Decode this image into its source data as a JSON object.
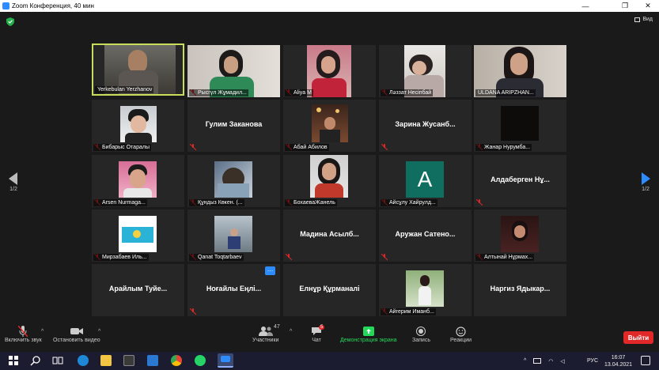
{
  "window": {
    "title": "Zoom Конференция, 40 мин"
  },
  "view": {
    "label": "Вид"
  },
  "pager": {
    "left": "1/2",
    "right": "1/2"
  },
  "tiles": [
    {
      "name": "Yerkebulan Yerzhanov",
      "video": true,
      "active": true,
      "muted": false
    },
    {
      "name": "Рысгүл Жұмадил...",
      "video": true,
      "muted": true
    },
    {
      "name": "Aliya M",
      "video": true,
      "muted": true
    },
    {
      "name": "Ләззат Несіпбай",
      "video": true,
      "muted": true
    },
    {
      "name": "ULDANA ARIPZHAN...",
      "video": true,
      "muted": false
    },
    {
      "name": "Бибарыс Отаралы",
      "video": true,
      "muted": true
    },
    {
      "name": "Гулим Заканова",
      "video": false,
      "muted": true
    },
    {
      "name": "Абай Абилов",
      "video": true,
      "muted": true
    },
    {
      "name": "Зарина Жусанб...",
      "video": false,
      "muted": true
    },
    {
      "name": "Жанар Нурумба...",
      "video": true,
      "muted": true
    },
    {
      "name": "Arsen Nurmaga...",
      "video": true,
      "muted": true
    },
    {
      "name": "Құндыз Көкен. (...",
      "video": true,
      "muted": true
    },
    {
      "name": "БохаеваЖанель",
      "video": true,
      "muted": true
    },
    {
      "name": "Айсұлу Хайрулд...",
      "video": true,
      "avatar_letter": "A",
      "muted": true
    },
    {
      "name": "Алдаберген Нұ...",
      "video": false,
      "muted": true
    },
    {
      "name": "Мирзабаев Иль...",
      "video": true,
      "muted": true
    },
    {
      "name": "Qanat Toqtarbaev",
      "video": true,
      "muted": true
    },
    {
      "name": "Мадина Асылб...",
      "video": false,
      "muted": true
    },
    {
      "name": "Аружан Сатено...",
      "video": false,
      "muted": true
    },
    {
      "name": "Алтынай Нұрмах...",
      "video": true,
      "muted": true
    },
    {
      "name": "Арайлым Туйе...",
      "video": false,
      "muted": false
    },
    {
      "name": "Ноғайлы Еңлі...",
      "video": false,
      "muted": true
    },
    {
      "name": "Елнұр Құрманалі",
      "video": false,
      "muted": false
    },
    {
      "name": "Айгерим Иманб...",
      "video": true,
      "muted": true
    },
    {
      "name": "Наргиз Ядыкар...",
      "video": false,
      "muted": false
    }
  ],
  "toolbar": {
    "unmute": "Включить звук",
    "stop_video": "Остановить видео",
    "participants": "Участники",
    "participants_count": "47",
    "chat": "Чат",
    "chat_badge": "5",
    "share": "Демонстрация экрана",
    "record": "Запись",
    "reactions": "Реакции",
    "exit": "Выйти"
  },
  "taskbar": {
    "lang": "РУС",
    "time": "16:07",
    "date": "13.04.2021"
  },
  "colors": {
    "active_border": "#c9dd5a",
    "share_green": "#23d959",
    "exit_red": "#e02828",
    "muted_red": "#e02828"
  }
}
